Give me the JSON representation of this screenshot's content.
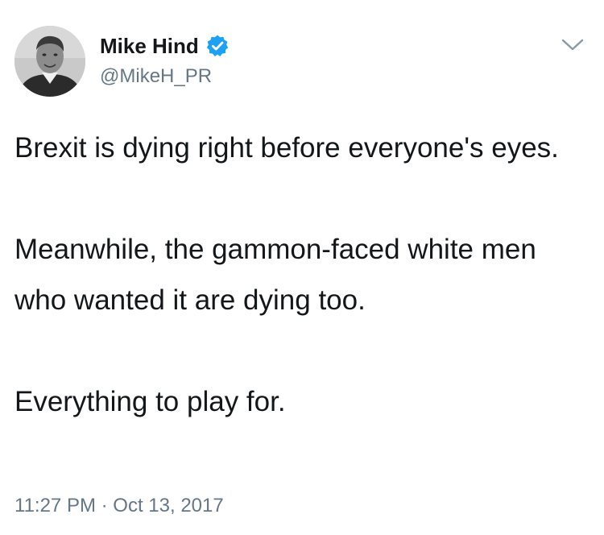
{
  "user": {
    "display_name": "Mike Hind",
    "handle": "@MikeH_PR",
    "verified": true
  },
  "icons": {
    "verified": "verified-badge-icon",
    "menu": "chevron-down-icon"
  },
  "tweet": {
    "paragraphs": [
      "Brexit is dying right before everyone's eyes.",
      "Meanwhile, the gammon-faced white men who wanted it are dying too.",
      "Everything to play for."
    ],
    "time": "11:27 PM",
    "separator": "·",
    "date": "Oct 13, 2017"
  },
  "colors": {
    "text": "#14171a",
    "secondary": "#657786",
    "verified_blue": "#1da1f2"
  }
}
